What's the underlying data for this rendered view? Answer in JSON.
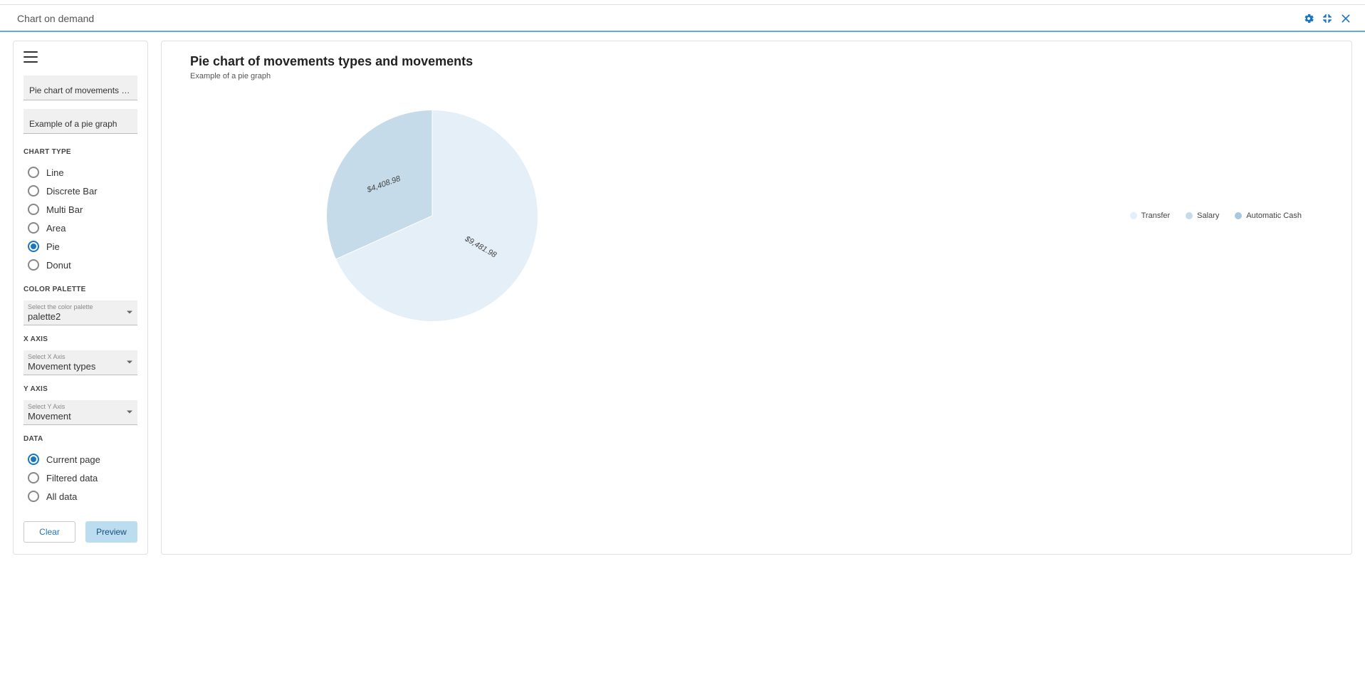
{
  "header": {
    "title": "Chart on demand"
  },
  "sidebar": {
    "title_value": "Pie chart of movements types and movements",
    "subtitle_value": "Example of a pie graph",
    "chart_type_label": "CHART TYPE",
    "chart_types": {
      "line": {
        "label": "Line",
        "checked": false
      },
      "dbar": {
        "label": "Discrete Bar",
        "checked": false
      },
      "mbar": {
        "label": "Multi Bar",
        "checked": false
      },
      "area": {
        "label": "Area",
        "checked": false
      },
      "pie": {
        "label": "Pie",
        "checked": true
      },
      "donut": {
        "label": "Donut",
        "checked": false
      }
    },
    "palette_label": "COLOR PALETTE",
    "palette_select": {
      "floating": "Select the color palette",
      "value": "palette2"
    },
    "xaxis_label": "X AXIS",
    "xaxis_select": {
      "floating": "Select X Axis",
      "value": "Movement types"
    },
    "yaxis_label": "Y AXIS",
    "yaxis_select": {
      "floating": "Select Y Axis",
      "value": "Movement"
    },
    "data_label": "DATA",
    "data_scope": {
      "current": {
        "label": "Current page",
        "checked": true
      },
      "filtered": {
        "label": "Filtered data",
        "checked": false
      },
      "all": {
        "label": "All data",
        "checked": false
      }
    },
    "buttons": {
      "clear": "Clear",
      "preview": "Preview"
    }
  },
  "chart_header": {
    "title": "Pie chart of movements types and movements",
    "subtitle": "Example of a pie graph"
  },
  "legend": {
    "items": [
      {
        "label": "Transfer",
        "color": "#e4eff8"
      },
      {
        "label": "Salary",
        "color": "#c6dbe9"
      },
      {
        "label": "Automatic Cash",
        "color": "#a7c8de"
      }
    ]
  },
  "chart_data": {
    "type": "pie",
    "title": "Pie chart of movements types and movements",
    "subtitle": "Example of a pie graph",
    "series": [
      {
        "name": "Transfer",
        "value": 9481.98,
        "label": "$9,481.98",
        "color": "#e4eff8"
      },
      {
        "name": "Salary",
        "value": 4408.98,
        "label": "$4,408.98",
        "color": "#c6dbe9"
      },
      {
        "name": "Automatic Cash",
        "value": 0,
        "label": "",
        "color": "#a7c8de"
      }
    ],
    "legend_position": "right"
  }
}
